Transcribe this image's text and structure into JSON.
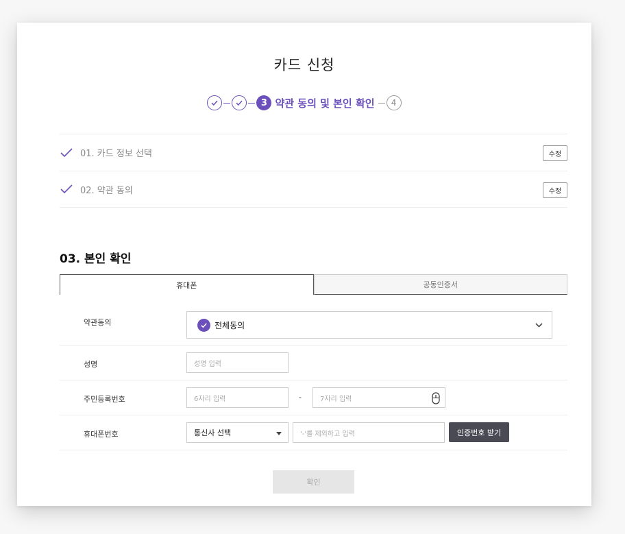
{
  "page": {
    "title": "카드 신청"
  },
  "stepper": {
    "active_number": "3",
    "active_label": "약관 동의 및 본인 확인",
    "next_number": "4"
  },
  "done_steps": [
    {
      "label": "01. 카드 정보 선택",
      "edit_label": "수정"
    },
    {
      "label": "02. 약관 동의",
      "edit_label": "수정"
    }
  ],
  "section": {
    "title": "03. 본인 확인"
  },
  "tabs": [
    {
      "label": "휴대폰",
      "active": true
    },
    {
      "label": "공동인증서",
      "active": false
    }
  ],
  "form": {
    "agree": {
      "label": "약관동의",
      "value": "전체동의"
    },
    "name": {
      "label": "성명",
      "placeholder": "성명 입력"
    },
    "rrn": {
      "label": "주민등록번호",
      "front_placeholder": "6자리 입력",
      "separator": "-",
      "back_placeholder": "7자리 입력"
    },
    "phone": {
      "label": "휴대폰번호",
      "carrier_value": "통신사 선택",
      "number_placeholder": "'-'를 제외하고 입력",
      "auth_button": "인증번호 받기"
    }
  },
  "actions": {
    "confirm_label": "확인"
  },
  "colors": {
    "accent": "#6b4fbb",
    "dark_button": "#4a4a55",
    "disabled_button": "#e6e6e6"
  }
}
